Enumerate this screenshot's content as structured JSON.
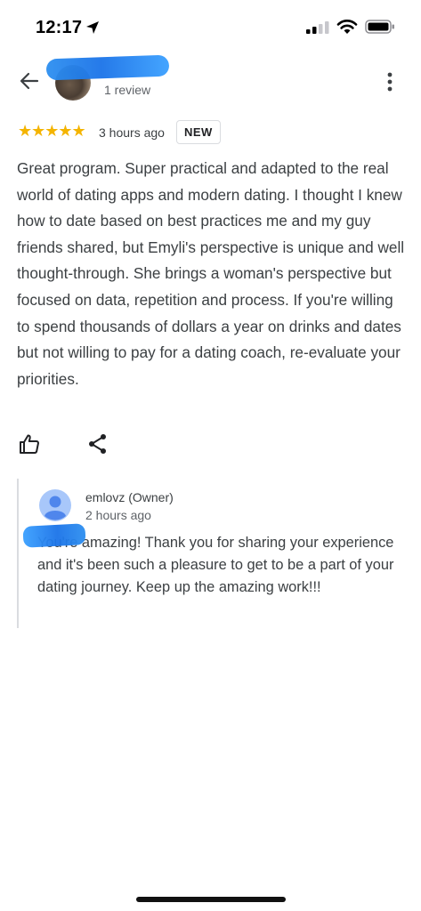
{
  "status_bar": {
    "time": "12:17"
  },
  "header": {
    "review_count": "1 review"
  },
  "review": {
    "stars": "★★★★★",
    "rating": 5,
    "time_ago": "3 hours ago",
    "badge": "NEW",
    "text": "Great program. Super practical and adapted to the real world of dating apps and modern dating. I thought I knew how to date based on best practices me and my guy friends shared, but Emyli's perspective is unique and well thought-through. She brings a woman's perspective but focused on data, repetition and process. If you're willing to spend thousands of dollars a year on drinks and dates but not willing to pay for a dating coach, re-evaluate your priorities."
  },
  "reply": {
    "author": "emlovz (Owner)",
    "time_ago": "2 hours ago",
    "text": "You're amazing! Thank you for sharing your experience and it's been such a pleasure to get to be a part of your dating journey. Keep up the amazing work!!!"
  },
  "icons": {
    "back": "arrow-left-icon",
    "more": "more-vert-icon",
    "like": "thumb-up-icon",
    "share": "share-icon"
  },
  "colors": {
    "star": "#f4b400",
    "redaction": "#1a73e8",
    "avatar_blue": "#4f86ec"
  }
}
